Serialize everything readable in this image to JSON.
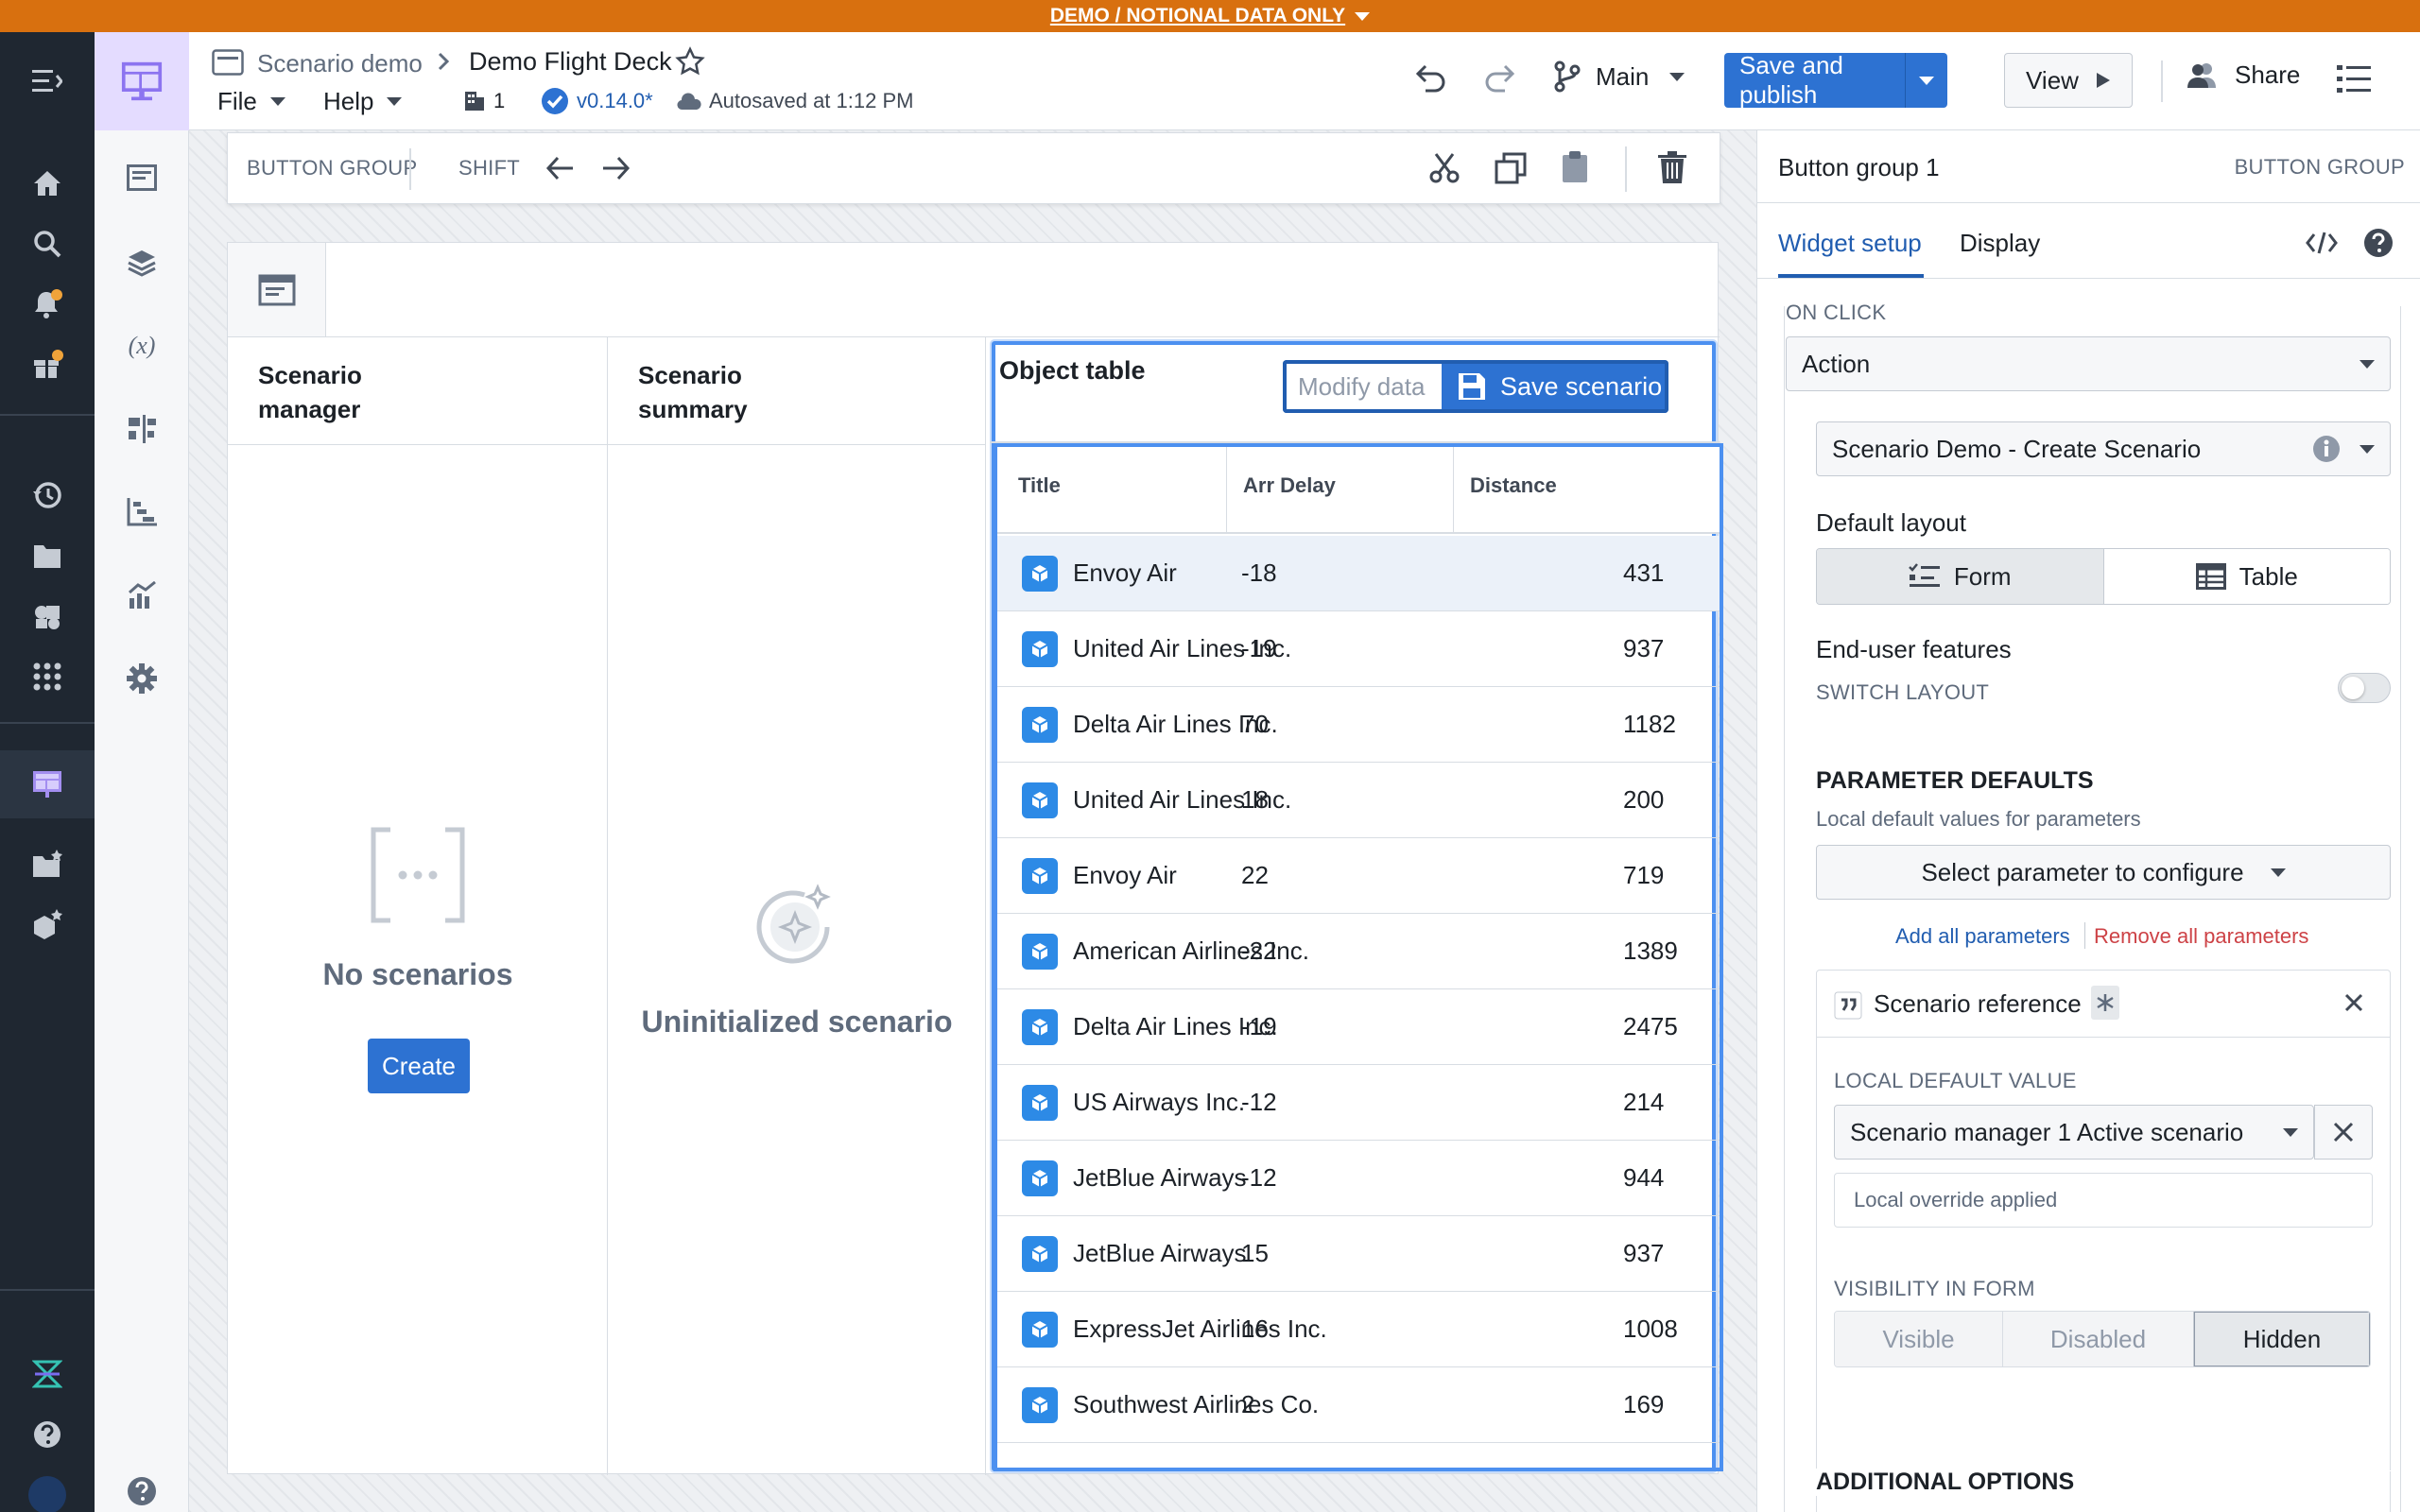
{
  "banner": {
    "text": "DEMO / NOTIONAL DATA ONLY"
  },
  "header": {
    "breadcrumb_parent": "Scenario demo",
    "title": "Demo Flight Deck",
    "menu_file": "File",
    "menu_help": "Help",
    "org_count": "1",
    "version": "v0.14.0*",
    "autosave": "Autosaved at 1:12 PM",
    "branch": "Main",
    "save_publish": "Save and publish",
    "view": "View",
    "share": "Share"
  },
  "toolbar": {
    "group_label": "BUTTON GROUP",
    "shift_label": "SHIFT"
  },
  "widgets": {
    "scenario_manager_title": "Scenario manager",
    "no_scenarios": "No scenarios",
    "create": "Create",
    "scenario_summary_title": "Scenario summary",
    "uninitialized": "Uninitialized scenario",
    "object_table_title": "Object table",
    "modify_placeholder": "Modify data",
    "save_scenario": "Save scenario"
  },
  "table": {
    "columns": [
      "Title",
      "Arr Delay",
      "Distance"
    ],
    "rows": [
      [
        "Envoy Air",
        "-18",
        "431"
      ],
      [
        "United Air Lines Inc.",
        "-19",
        "937"
      ],
      [
        "Delta Air Lines Inc.",
        "70",
        "1182"
      ],
      [
        "United Air Lines Inc.",
        "18",
        "200"
      ],
      [
        "Envoy Air",
        "22",
        "719"
      ],
      [
        "American Airlines Inc.",
        "-22",
        "1389"
      ],
      [
        "Delta Air Lines Inc.",
        "-19",
        "2475"
      ],
      [
        "US Airways Inc.",
        "-12",
        "214"
      ],
      [
        "JetBlue Airways",
        "-12",
        "944"
      ],
      [
        "JetBlue Airways",
        "15",
        "937"
      ],
      [
        "ExpressJet Airlines Inc.",
        "16",
        "1008"
      ],
      [
        "Southwest Airlines Co.",
        "2",
        "169"
      ]
    ]
  },
  "panel": {
    "title": "Button group 1",
    "type": "BUTTON GROUP",
    "tab_setup": "Widget setup",
    "tab_display": "Display",
    "on_click_label": "ON CLICK",
    "on_click_value": "Action",
    "action_value": "Scenario Demo - Create Scenario",
    "default_layout": "Default layout",
    "layout_form": "Form",
    "layout_table": "Table",
    "end_user": "End-user features",
    "switch_layout": "SWITCH LAYOUT",
    "param_defaults": "PARAMETER DEFAULTS",
    "param_desc": "Local default values for parameters",
    "select_param": "Select parameter to configure",
    "add_all": "Add all parameters",
    "remove_all": "Remove all parameters",
    "param_name": "Scenario reference",
    "local_default_label": "LOCAL DEFAULT VALUE",
    "local_default_value": "Scenario manager 1 Active scenario",
    "override": "Local override applied",
    "visibility_label": "VISIBILITY IN FORM",
    "vis_visible": "Visible",
    "vis_disabled": "Disabled",
    "vis_hidden": "Hidden",
    "additional": "ADDITIONAL OPTIONS"
  }
}
